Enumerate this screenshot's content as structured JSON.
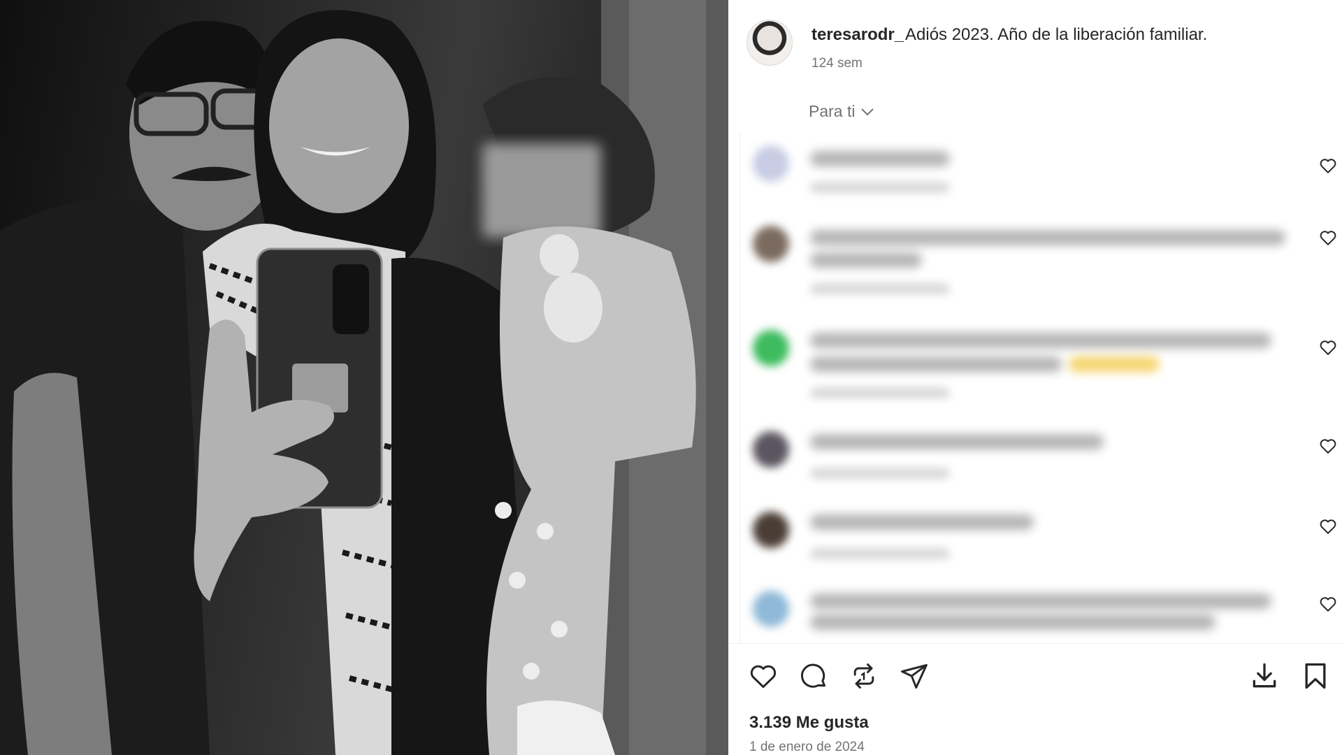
{
  "post": {
    "username": "teresarodr_",
    "caption": "Adiós 2023. Año de la liberación familiar.",
    "age": "124 sem",
    "likes": "3.139 Me gusta",
    "date": "1 de enero de 2024"
  },
  "comments_filter": {
    "label": "Para ti"
  },
  "icons": {
    "like": "heart-icon",
    "comment": "comment-icon",
    "repost": "repost-icon",
    "share": "share-icon",
    "download": "download-icon",
    "save": "bookmark-icon",
    "filter": "chevron-down-icon"
  },
  "colors": {
    "text": "#262626",
    "secondary": "#737373",
    "photo_bg": "#1a1a1a"
  }
}
